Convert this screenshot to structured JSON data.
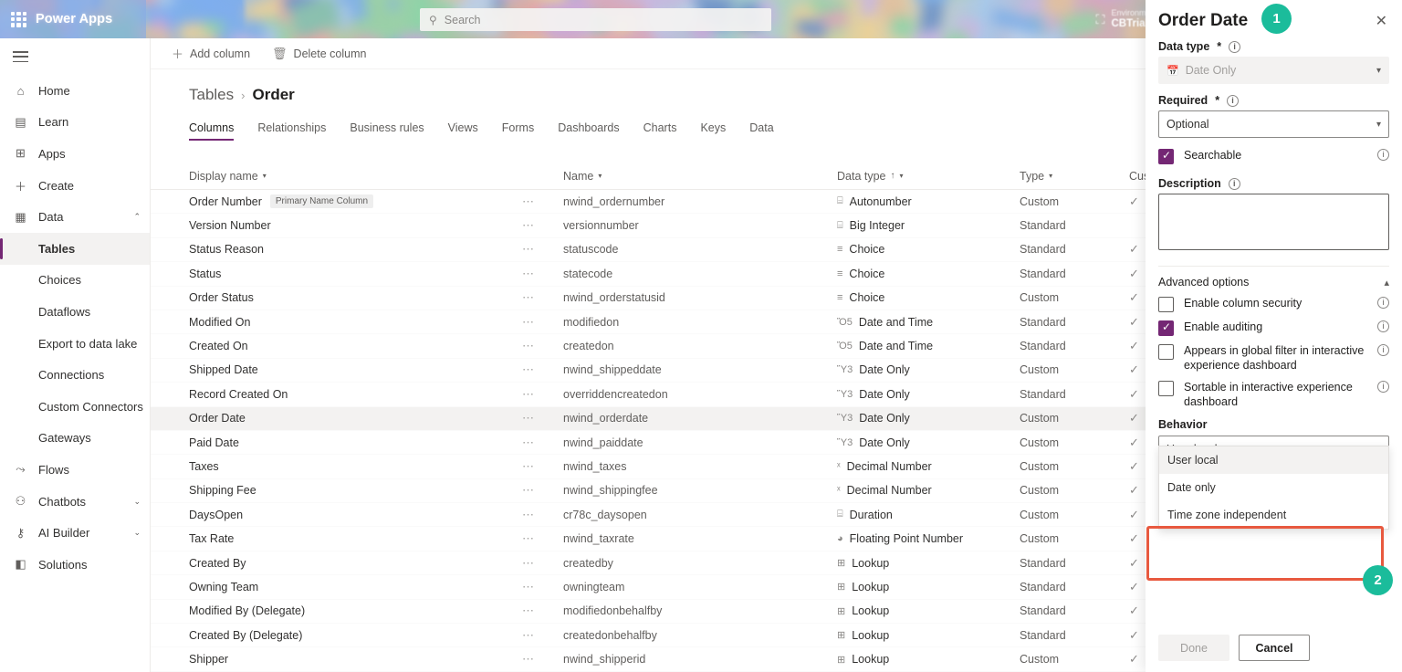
{
  "topbar": {
    "brand": "Power Apps",
    "waffle_icon": "app-launcher-icon",
    "search_placeholder": "Search",
    "search_icon": "search-icon",
    "env_label": "Environment",
    "env_name": "CBTrial",
    "env_icon": "environment-icon"
  },
  "sidebar": {
    "hamburger_icon": "hamburger-icon",
    "items": [
      {
        "label": "Home",
        "icon": "home-icon",
        "glyph": "⌂",
        "level": 0,
        "chev": ""
      },
      {
        "label": "Learn",
        "icon": "book-icon",
        "glyph": "▤",
        "level": 0,
        "chev": ""
      },
      {
        "label": "Apps",
        "icon": "apps-icon",
        "glyph": "⊞",
        "level": 0,
        "chev": ""
      },
      {
        "label": "Create",
        "icon": "plus-icon",
        "glyph": "＋",
        "level": 0,
        "chev": ""
      },
      {
        "label": "Data",
        "icon": "table-icon",
        "glyph": "▦",
        "level": 0,
        "chev": "⌃"
      },
      {
        "label": "Tables",
        "icon": "",
        "glyph": "",
        "level": 1,
        "chev": "",
        "active": true
      },
      {
        "label": "Choices",
        "icon": "",
        "glyph": "",
        "level": 1,
        "chev": ""
      },
      {
        "label": "Dataflows",
        "icon": "",
        "glyph": "",
        "level": 1,
        "chev": ""
      },
      {
        "label": "Export to data lake",
        "icon": "",
        "glyph": "",
        "level": 1,
        "chev": ""
      },
      {
        "label": "Connections",
        "icon": "",
        "glyph": "",
        "level": 1,
        "chev": ""
      },
      {
        "label": "Custom Connectors",
        "icon": "",
        "glyph": "",
        "level": 1,
        "chev": ""
      },
      {
        "label": "Gateways",
        "icon": "",
        "glyph": "",
        "level": 1,
        "chev": ""
      },
      {
        "label": "Flows",
        "icon": "flows-icon",
        "glyph": "⤳",
        "level": 0,
        "chev": ""
      },
      {
        "label": "Chatbots",
        "icon": "chatbot-icon",
        "glyph": "⚇",
        "level": 0,
        "chev": "⌄"
      },
      {
        "label": "AI Builder",
        "icon": "ai-builder-icon",
        "glyph": "⚷",
        "level": 0,
        "chev": "⌄"
      },
      {
        "label": "Solutions",
        "icon": "solutions-icon",
        "glyph": "◧",
        "level": 0,
        "chev": ""
      }
    ]
  },
  "command_bar": {
    "add_column": "Add column",
    "add_column_icon": "plus-icon",
    "delete_column": "Delete column",
    "delete_column_icon": "trash-icon"
  },
  "breadcrumb": {
    "root": "Tables",
    "separator": "›",
    "current": "Order"
  },
  "tabs": [
    {
      "label": "Columns",
      "active": true
    },
    {
      "label": "Relationships",
      "active": false
    },
    {
      "label": "Business rules",
      "active": false
    },
    {
      "label": "Views",
      "active": false
    },
    {
      "label": "Forms",
      "active": false
    },
    {
      "label": "Dashboards",
      "active": false
    },
    {
      "label": "Charts",
      "active": false
    },
    {
      "label": "Keys",
      "active": false
    },
    {
      "label": "Data",
      "active": false
    }
  ],
  "grid": {
    "columns": [
      {
        "label": "Display name",
        "sorted": ""
      },
      {
        "label": "Name",
        "sorted": ""
      },
      {
        "label": "Data type",
        "sorted": "asc"
      },
      {
        "label": "Type",
        "sorted": ""
      },
      {
        "label": "Customizable",
        "sorted": ""
      }
    ],
    "primary_badge": "Primary Name Column",
    "rows": [
      {
        "display": "Order Number",
        "badge": "Primary Name Column",
        "name": "nwind_ordernumber",
        "dtype": "Autonumber",
        "dicon": "autonumber-icon",
        "dglyph": "⌸",
        "type": "Custom",
        "customizable": true,
        "selected": false
      },
      {
        "display": "Version Number",
        "badge": "",
        "name": "versionnumber",
        "dtype": "Big Integer",
        "dicon": "big-integer-icon",
        "dglyph": "⌸",
        "type": "Standard",
        "customizable": false,
        "selected": false
      },
      {
        "display": "Status Reason",
        "badge": "",
        "name": "statuscode",
        "dtype": "Choice",
        "dicon": "choice-icon",
        "dglyph": "≡",
        "type": "Standard",
        "customizable": true,
        "selected": false
      },
      {
        "display": "Status",
        "badge": "",
        "name": "statecode",
        "dtype": "Choice",
        "dicon": "choice-icon",
        "dglyph": "≡",
        "type": "Standard",
        "customizable": true,
        "selected": false
      },
      {
        "display": "Order Status",
        "badge": "",
        "name": "nwind_orderstatusid",
        "dtype": "Choice",
        "dicon": "choice-icon",
        "dglyph": "≡",
        "type": "Custom",
        "customizable": true,
        "selected": false
      },
      {
        "display": "Modified On",
        "badge": "",
        "name": "modifiedon",
        "dtype": "Date and Time",
        "dicon": "date-time-icon",
        "dglyph": "Ὄ5",
        "type": "Standard",
        "customizable": true,
        "selected": false
      },
      {
        "display": "Created On",
        "badge": "",
        "name": "createdon",
        "dtype": "Date and Time",
        "dicon": "date-time-icon",
        "dglyph": "Ὄ5",
        "type": "Standard",
        "customizable": true,
        "selected": false
      },
      {
        "display": "Shipped Date",
        "badge": "",
        "name": "nwind_shippeddate",
        "dtype": "Date Only",
        "dicon": "date-only-icon",
        "dglyph": "Ὕ3",
        "type": "Custom",
        "customizable": true,
        "selected": false
      },
      {
        "display": "Record Created On",
        "badge": "",
        "name": "overriddencreatedon",
        "dtype": "Date Only",
        "dicon": "date-only-icon",
        "dglyph": "Ὕ3",
        "type": "Standard",
        "customizable": true,
        "selected": false
      },
      {
        "display": "Order Date",
        "badge": "",
        "name": "nwind_orderdate",
        "dtype": "Date Only",
        "dicon": "date-only-icon",
        "dglyph": "Ὕ3",
        "type": "Custom",
        "customizable": true,
        "selected": true
      },
      {
        "display": "Paid Date",
        "badge": "",
        "name": "nwind_paiddate",
        "dtype": "Date Only",
        "dicon": "date-only-icon",
        "dglyph": "Ὕ3",
        "type": "Custom",
        "customizable": true,
        "selected": false
      },
      {
        "display": "Taxes",
        "badge": "",
        "name": "nwind_taxes",
        "dtype": "Decimal Number",
        "dicon": "decimal-number-icon",
        "dglyph": "ˣ",
        "type": "Custom",
        "customizable": true,
        "selected": false
      },
      {
        "display": "Shipping Fee",
        "badge": "",
        "name": "nwind_shippingfee",
        "dtype": "Decimal Number",
        "dicon": "decimal-number-icon",
        "dglyph": "ˣ",
        "type": "Custom",
        "customizable": true,
        "selected": false
      },
      {
        "display": "DaysOpen",
        "badge": "",
        "name": "cr78c_daysopen",
        "dtype": "Duration",
        "dicon": "duration-icon",
        "dglyph": "⌸",
        "type": "Custom",
        "customizable": true,
        "selected": false
      },
      {
        "display": "Tax Rate",
        "badge": "",
        "name": "nwind_taxrate",
        "dtype": "Floating Point Number",
        "dicon": "floating-point-icon",
        "dglyph": "◕",
        "type": "Custom",
        "customizable": true,
        "selected": false
      },
      {
        "display": "Created By",
        "badge": "",
        "name": "createdby",
        "dtype": "Lookup",
        "dicon": "lookup-icon",
        "dglyph": "⊞",
        "type": "Standard",
        "customizable": true,
        "selected": false
      },
      {
        "display": "Owning Team",
        "badge": "",
        "name": "owningteam",
        "dtype": "Lookup",
        "dicon": "lookup-icon",
        "dglyph": "⊞",
        "type": "Standard",
        "customizable": true,
        "selected": false
      },
      {
        "display": "Modified By (Delegate)",
        "badge": "",
        "name": "modifiedonbehalfby",
        "dtype": "Lookup",
        "dicon": "lookup-icon",
        "dglyph": "⊞",
        "type": "Standard",
        "customizable": true,
        "selected": false
      },
      {
        "display": "Created By (Delegate)",
        "badge": "",
        "name": "createdonbehalfby",
        "dtype": "Lookup",
        "dicon": "lookup-icon",
        "dglyph": "⊞",
        "type": "Standard",
        "customizable": true,
        "selected": false
      },
      {
        "display": "Shipper",
        "badge": "",
        "name": "nwind_shipperid",
        "dtype": "Lookup",
        "dicon": "lookup-icon",
        "dglyph": "⊞",
        "type": "Custom",
        "customizable": true,
        "selected": false
      }
    ]
  },
  "panel": {
    "title": "Order Date",
    "close_icon": "close-icon",
    "data_type_label": "Data type",
    "data_type_required_mark": "*",
    "data_type_value": "Date Only",
    "data_type_icon": "date-only-icon",
    "required_label": "Required",
    "required_required_mark": "*",
    "required_value": "Optional",
    "searchable_label": "Searchable",
    "searchable_checked": true,
    "description_label": "Description",
    "description_value": "",
    "advanced_options_label": "Advanced options",
    "advanced_expanded": true,
    "checkboxes": [
      {
        "label": "Enable column security",
        "checked": false,
        "name": "enable-column-security"
      },
      {
        "label": "Enable auditing",
        "checked": true,
        "name": "enable-auditing"
      },
      {
        "label": "Appears in global filter in interactive experience dashboard",
        "checked": false,
        "name": "appears-in-global-filter"
      },
      {
        "label": "Sortable in interactive experience dashboard",
        "checked": false,
        "name": "sortable-in-interactive-dashboard"
      }
    ],
    "behavior_label": "Behavior",
    "behavior_value": "User local",
    "behavior_options": [
      {
        "label": "User local",
        "selected": true
      },
      {
        "label": "Date only",
        "selected": false
      },
      {
        "label": "Time zone independent",
        "selected": false
      }
    ],
    "done_label": "Done",
    "cancel_label": "Cancel",
    "info_icon": "info-icon",
    "chevron_down_icon": "chevron-down-icon",
    "chevron_up_icon": "chevron-up-icon"
  },
  "annotations": {
    "badge_1": "1",
    "badge_2": "2",
    "highlight_color": "#e8593f",
    "badge_color": "#1bbc9b"
  },
  "theme": {
    "accent": "#742774",
    "header_blue": "#86aae6"
  }
}
